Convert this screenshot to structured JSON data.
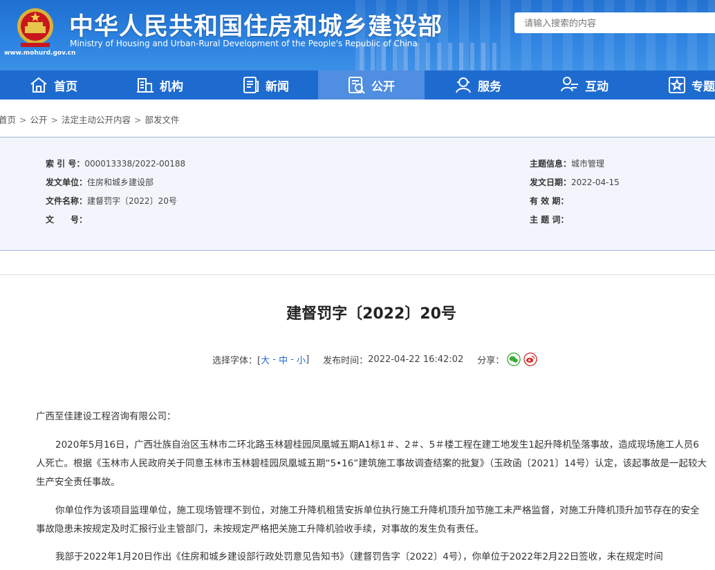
{
  "header": {
    "title_cn": "中华人民共和国住房和城乡建设部",
    "title_en": "Ministry of Housing and Urban-Rural Development of the People's Republic of China",
    "url": "www.mohurd.gov.cn",
    "search_placeholder": "请输入搜索的内容"
  },
  "nav": {
    "items": [
      {
        "label": "首页",
        "icon": "home-icon"
      },
      {
        "label": "机构",
        "icon": "building-icon"
      },
      {
        "label": "新闻",
        "icon": "news-icon"
      },
      {
        "label": "公开",
        "icon": "disclosure-icon"
      },
      {
        "label": "服务",
        "icon": "service-icon"
      },
      {
        "label": "互动",
        "icon": "interaction-icon"
      },
      {
        "label": "专题",
        "icon": "topic-icon"
      }
    ],
    "active": "公开"
  },
  "breadcrumb": [
    "首页",
    "公开",
    "法定主动公开内容",
    "部发文件"
  ],
  "meta": {
    "index_label": "索 引 号：",
    "index_value": "000013338/2022-00188",
    "issuer_label": "发文单位：",
    "issuer_value": "住房和城乡建设部",
    "filename_label": "文件名称：",
    "filename_value": "建督罚字〔2022〕20号",
    "docno_label": "文　　号：",
    "docno_value": "",
    "topic_label": "主题信息：",
    "topic_value": "城市管理",
    "date_label": "发文日期：",
    "date_value": "2022-04-15",
    "validity_label": "有 效 期：",
    "validity_value": "",
    "keywords_label": "主 题 词：",
    "keywords_value": ""
  },
  "doc": {
    "title": "建督罚字〔2022〕20号",
    "font_select_label": "选择字体：[",
    "font_large": "大",
    "font_medium": "中",
    "font_small": "小",
    "font_close": "]",
    "publish_label": "发布时间：",
    "publish_time": "2022-04-22 16:42:02",
    "share_label": "分享：",
    "salutation": "广西至佳建设工程咨询有限公司：",
    "para1": "2020年5月16日，广西壮族自治区玉林市二环北路玉林碧桂园凤凰城五期A1标1＃、2＃、5＃楼工程在建工地发生1起升降机坠落事故，造成现场施工人员6人死亡。根据《玉林市人民政府关于同意玉林市玉林碧桂园凤凰城五期“5•16”建筑施工事故调查结案的批复》（玉政函〔2021〕14号）认定，该起事故是一起较大生产安全责任事故。",
    "para2": "你单位作为该项目监理单位，施工现场管理不到位，对施工升降机租赁安拆单位执行施工升降机顶升加节施工未严格监督，对施工升降机顶升加节存在的安全事故隐患未按规定及时汇报行业主管部门，未按规定严格把关施工升降机验收手续，对事故的发生负有责任。",
    "para3": "我部于2022年1月20日作出《住房和城乡建设部行政处罚意见告知书》（建督罚告字〔2022〕4号），你单位于2022年2月22日签收，未在规定时间"
  }
}
